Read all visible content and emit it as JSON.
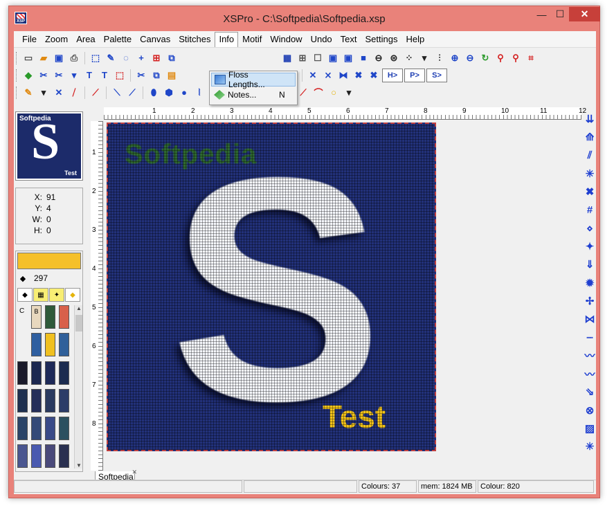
{
  "window": {
    "title": "XSPro - C:\\Softpedia\\Softpedia.xsp",
    "app_icon_text": "XSP",
    "minimize": "—",
    "maximize": "☐",
    "close": "✕"
  },
  "menu": [
    "File",
    "Zoom",
    "Area",
    "Palette",
    "Canvas",
    "Stitches",
    "Info",
    "Motif",
    "Window",
    "Undo",
    "Text",
    "Settings",
    "Help"
  ],
  "active_menu": "Info",
  "dropdown": {
    "items": [
      {
        "label": "Floss Lengths...",
        "shortcut": "",
        "icon": "floss-icon"
      },
      {
        "label": "Notes...",
        "shortcut": "N",
        "icon": "notes-icon"
      }
    ]
  },
  "toolbar": {
    "h_buttons": [
      "H>",
      "P>",
      "S>"
    ]
  },
  "thumbnail": {
    "word": "Softpedia",
    "letter": "S",
    "caption": "Test"
  },
  "coords": {
    "x_label": "X:",
    "x": "91",
    "y_label": "Y:",
    "y": "4",
    "w_label": "W:",
    "w": "0",
    "h_label": "H:",
    "h": "0"
  },
  "palette": {
    "current_color": "#f5c02a",
    "current_number": "297",
    "label_c": "C",
    "label_b": "B",
    "scroll_up": "▲",
    "scroll_down": "▼",
    "swatches": [
      "#e8d8be",
      "#2f5a3a",
      "#d8604a",
      "#2f5fa0",
      "#f0c020",
      "#30609a",
      "#1a1a2a",
      "#1c2850",
      "#1e2a58",
      "#1c2c50",
      "#1e3050",
      "#242e5a",
      "#2a3a60",
      "#2c3c68",
      "#2a4468",
      "#344a78",
      "#3a4a88",
      "#2c5060",
      "#4a5690",
      "#4a5ab0",
      "#4a4a7a",
      "#2a3050"
    ]
  },
  "ruler_top": [
    "1",
    "2",
    "3",
    "4",
    "5",
    "6",
    "7",
    "8",
    "9",
    "10",
    "11",
    "12"
  ],
  "ruler_left": [
    "1",
    "2",
    "3",
    "4",
    "5",
    "6",
    "7",
    "8"
  ],
  "canvas": {
    "bg_color": "#22317a",
    "watermark": "Softpedia",
    "letter": "S",
    "caption": "Test"
  },
  "doc_tab": {
    "label": "Softpedia",
    "close": "✕"
  },
  "status": {
    "cell1": "",
    "cell2": "",
    "colours": "Colours: 37",
    "mem": "mem: 1824 MB",
    "colour": "Colour: 820"
  }
}
